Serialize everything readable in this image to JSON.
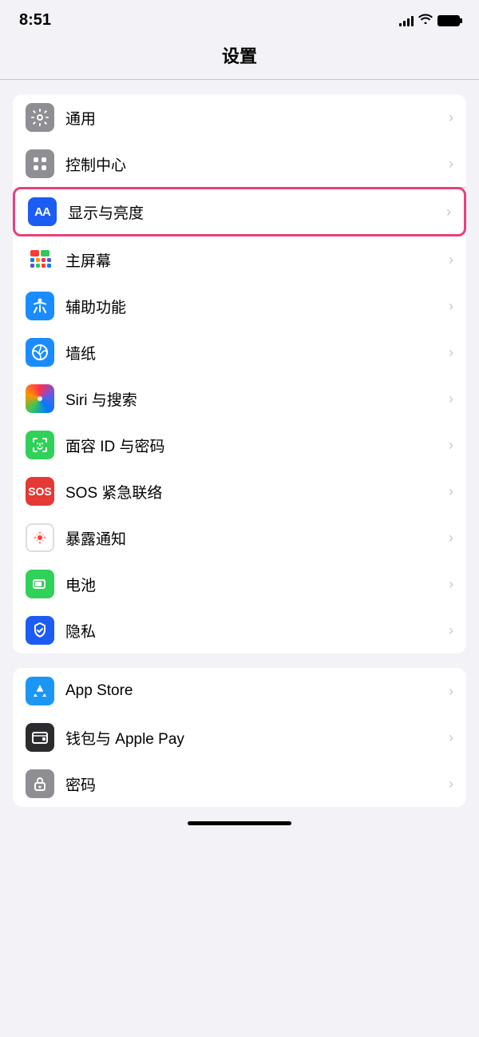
{
  "statusBar": {
    "time": "8:51",
    "signal": "full",
    "wifi": true,
    "battery": "full"
  },
  "pageTitle": "设置",
  "groups": [
    {
      "id": "group1",
      "items": [
        {
          "id": "general",
          "label": "通用",
          "iconType": "general",
          "highlighted": false
        },
        {
          "id": "control-center",
          "label": "控制中心",
          "iconType": "control",
          "highlighted": false
        },
        {
          "id": "display",
          "label": "显示与亮度",
          "iconType": "display",
          "highlighted": true
        },
        {
          "id": "home-screen",
          "label": "主屏幕",
          "iconType": "home",
          "highlighted": false
        },
        {
          "id": "accessibility",
          "label": "辅助功能",
          "iconType": "accessibility",
          "highlighted": false
        },
        {
          "id": "wallpaper",
          "label": "墙纸",
          "iconType": "wallpaper",
          "highlighted": false
        },
        {
          "id": "siri",
          "label": "Siri 与搜索",
          "iconType": "siri",
          "highlighted": false
        },
        {
          "id": "faceid",
          "label": "面容 ID 与密码",
          "iconType": "faceid",
          "highlighted": false
        },
        {
          "id": "sos",
          "label": "SOS 紧急联络",
          "iconType": "sos",
          "highlighted": false
        },
        {
          "id": "exposure",
          "label": "暴露通知",
          "iconType": "exposure",
          "highlighted": false
        },
        {
          "id": "battery",
          "label": "电池",
          "iconType": "battery",
          "highlighted": false
        },
        {
          "id": "privacy",
          "label": "隐私",
          "iconType": "privacy",
          "highlighted": false
        }
      ]
    },
    {
      "id": "group2",
      "items": [
        {
          "id": "appstore",
          "label": "App Store",
          "iconType": "appstore",
          "highlighted": false
        },
        {
          "id": "wallet",
          "label": "钱包与 Apple Pay",
          "iconType": "wallet",
          "highlighted": false
        },
        {
          "id": "password",
          "label": "密码",
          "iconType": "password",
          "highlighted": false
        }
      ]
    }
  ],
  "chevron": "›"
}
